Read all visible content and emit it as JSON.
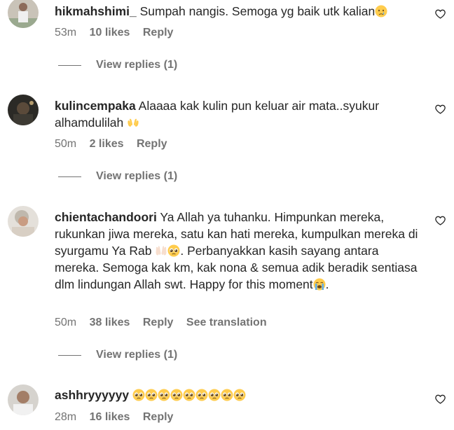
{
  "comments": [
    {
      "username": "hikmahshimi_",
      "text": "Sumpah nangis. Semoga yg baik utk kalian",
      "time": "53m",
      "likes": "10 likes",
      "reply": "Reply",
      "view_replies": "View replies (1)",
      "emoji": [
        "crying-face"
      ]
    },
    {
      "username": "kulincempaka",
      "text": "Alaaaa kak kulin pun keluar air mata..syukur alhamdulilah",
      "time": "50m",
      "likes": "2 likes",
      "reply": "Reply",
      "view_replies": "View replies (1)",
      "emoji": [
        "open-hands"
      ]
    },
    {
      "username": "chientachandoori",
      "text_a": "Ya Allah ya tuhanku. Himpunkan mereka, rukunkan jiwa mereka, satu kan hati mereka, kumpulkan mereka di syurgamu Ya Rab",
      "text_b": ". Perbanyakkan kasih sayang antara mereka. Semoga kak km, kak nona & semua adik beradik sentiasa dlm lindungan Allah swt. Happy for this moment",
      "text_c": ".",
      "time": "50m",
      "likes": "38 likes",
      "reply": "Reply",
      "see_translation": "See translation",
      "view_replies": "View replies (1)",
      "emoji": [
        "palms-up-together-light",
        "pleading-face",
        "loudly-crying-face"
      ]
    },
    {
      "username": "ashhryyyyyy",
      "text": "",
      "time": "28m",
      "likes": "16 likes",
      "reply": "Reply",
      "emoji": [
        "pleading-face",
        "pleading-face",
        "pleading-face",
        "pleading-face",
        "pleading-face",
        "pleading-face",
        "pleading-face",
        "pleading-face",
        "pleading-face"
      ]
    }
  ],
  "colors": {
    "text": "#262626",
    "secondary": "#737373",
    "background": "#ffffff"
  },
  "icons": {
    "like": "heart-outline-icon"
  }
}
